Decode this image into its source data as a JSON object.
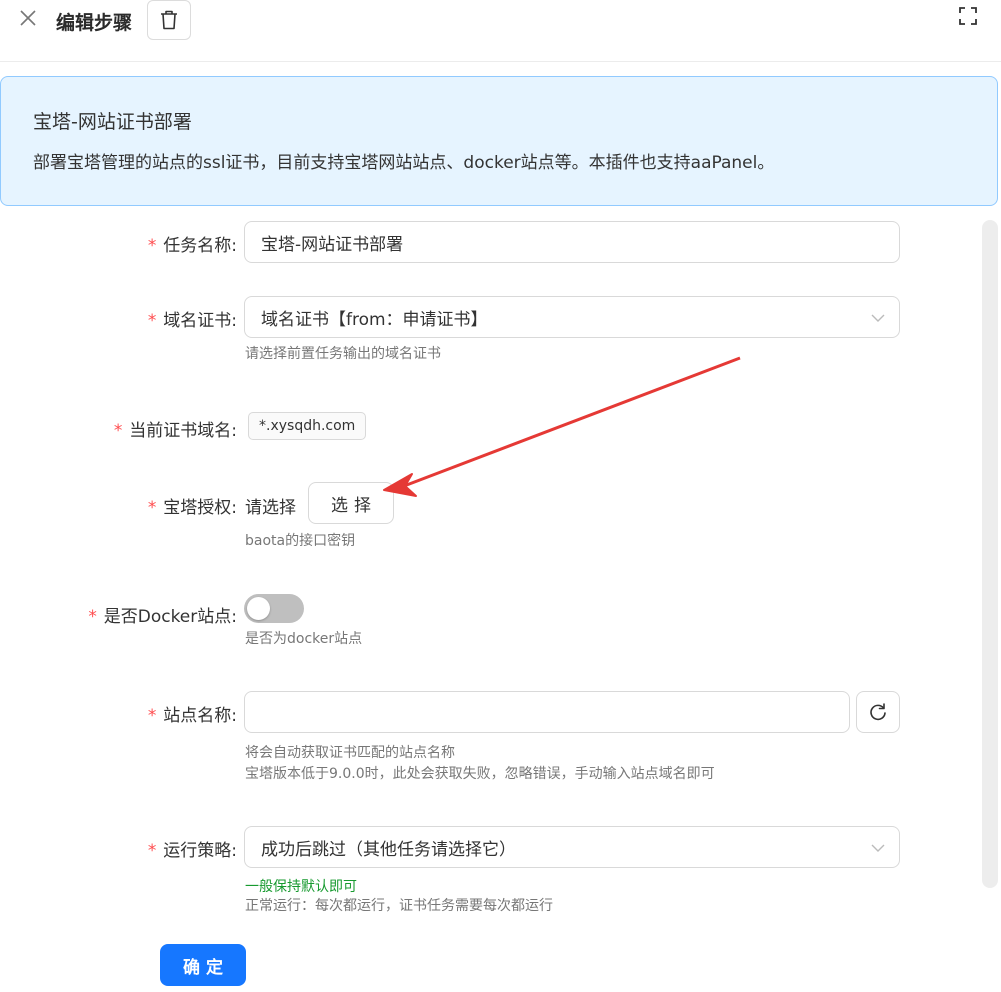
{
  "header": {
    "title": "编辑步骤",
    "close_icon": "close-icon",
    "delete_icon": "trash-icon",
    "fullscreen_icon": "fullscreen-icon"
  },
  "alert": {
    "title": "宝塔-网站证书部署",
    "description": "部署宝塔管理的站点的ssl证书，目前支持宝塔网站站点、docker站点等。本插件也支持aaPanel。"
  },
  "form": {
    "required_mark": "*",
    "task_name": {
      "label": "任务名称:",
      "value": "宝塔-网站证书部署"
    },
    "domain_cert": {
      "label": "域名证书:",
      "value": "域名证书【from：申请证书】",
      "hint": "请选择前置任务输出的域名证书"
    },
    "current_domain": {
      "label": "当前证书域名:",
      "tag": "*.xysqdh.com"
    },
    "baota_auth": {
      "label": "宝塔授权:",
      "placeholder": "请选择",
      "button": "选择",
      "hint": "baota的接口密钥"
    },
    "docker_site": {
      "label": "是否Docker站点:",
      "checked": false,
      "hint": "是否为docker站点"
    },
    "site_name": {
      "label": "站点名称:",
      "value": "",
      "hint_line1": "将会自动获取证书匹配的站点名称",
      "hint_line2": "宝塔版本低于9.0.0时，此处会获取失败，忽略错误，手动输入站点域名即可"
    },
    "strategy": {
      "label": "运行策略:",
      "value": "成功后跳过（其他任务请选择它）",
      "hint_green": "一般保持默认即可",
      "hint": "正常运行：每次都运行，证书任务需要每次都运行"
    },
    "confirm_button": "确定"
  },
  "colors": {
    "primary": "#1677ff",
    "alert_bg": "#e6f4ff",
    "alert_border": "#91caff",
    "required": "#ff4d4f",
    "hint_green": "#179a2f",
    "annotation_arrow": "#e53935"
  }
}
